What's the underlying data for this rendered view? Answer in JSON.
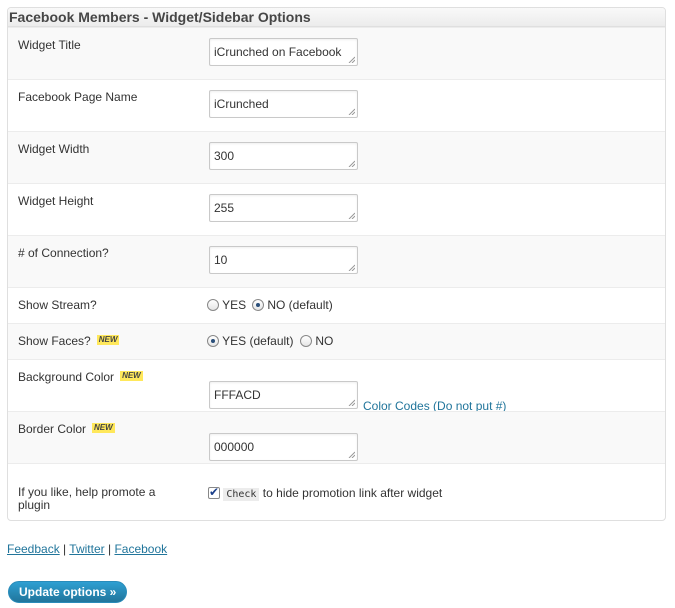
{
  "panel": {
    "title": "Facebook Members - Widget/Sidebar Options"
  },
  "fields": {
    "widget_title": {
      "label": "Widget Title",
      "value": "iCrunched on Facebook"
    },
    "page_name": {
      "label": "Facebook Page Name",
      "value": "iCrunched"
    },
    "width": {
      "label": "Widget Width",
      "value": "300"
    },
    "height": {
      "label": "Widget Height",
      "value": "255"
    },
    "connections": {
      "label": "# of Connection?",
      "value": "10"
    },
    "bg_color": {
      "label": "Background Color",
      "value": "FFFACD",
      "badge": "NEW"
    },
    "border_color": {
      "label": "Border Color",
      "value": "000000",
      "badge": "NEW"
    }
  },
  "show_stream": {
    "label": "Show Stream?",
    "opt_yes": "YES",
    "opt_no": "NO (default)",
    "selected": "NO (default)"
  },
  "show_faces": {
    "label": "Show Faces?",
    "badge": "NEW",
    "opt_yes": "YES (default)",
    "opt_no": "NO",
    "selected": "YES (default)"
  },
  "color_codes_link": "Color Codes (Do not put #)",
  "promote": {
    "label": "If you like, help promote a plugin",
    "checked": true,
    "check_code": "Check",
    "after_text": "to hide promotion link after widget"
  },
  "footer": {
    "feedback": "Feedback",
    "twitter": "Twitter",
    "facebook": "Facebook",
    "sep": "|"
  },
  "update_button": "Update options »"
}
